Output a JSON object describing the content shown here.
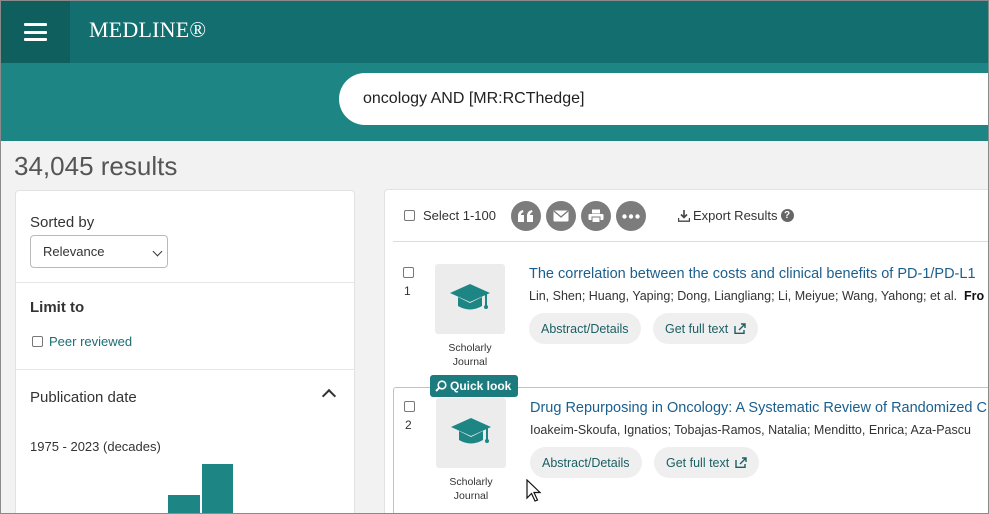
{
  "app": {
    "brand": "MEDLINE®"
  },
  "search": {
    "query": "oncology AND [MR:RCThedge]"
  },
  "results_count": "34,045 results",
  "sidebar": {
    "sort_label": "Sorted by",
    "sort_value": "Relevance",
    "limit_title": "Limit to",
    "peer_reviewed": "Peer reviewed",
    "pub_date_title": "Publication date",
    "decades_label": "1975 - 2023 (decades)"
  },
  "toolbar": {
    "select_label": "Select 1-100",
    "cite_icon": "quote-icon",
    "email_icon": "email-icon",
    "print_icon": "print-icon",
    "more_icon": "more-icon",
    "export_label": "Export Results",
    "help": "?"
  },
  "results": [
    {
      "number": "1",
      "type_line1": "Scholarly",
      "type_line2": "Journal",
      "title": "The correlation between the costs and clinical benefits of PD-1/PD-L1",
      "authors": "Lin, Shen; Huang, Yaping; Dong, Liangliang; Li, Meiyue; Wang, Yahong; et al.",
      "source_fragment": "Fro",
      "abstract_btn": "Abstract/Details",
      "fulltext_btn": "Get full text"
    },
    {
      "number": "2",
      "type_line1": "Scholarly",
      "type_line2": "Journal",
      "title": "Drug Repurposing in Oncology: A Systematic Review of Randomized C",
      "authors": "Ioakeim-Skoufa, Ignatios; Tobajas-Ramos, Natalia; Menditto, Enrica; Aza-Pascu",
      "abstract_btn": "Abstract/Details",
      "fulltext_btn": "Get full text",
      "quick_look": "Quick look"
    }
  ],
  "colors": {
    "header": "#136f6f",
    "search_band": "#1e8585",
    "accent": "#1b7b7f",
    "link": "#1b5f8e"
  }
}
